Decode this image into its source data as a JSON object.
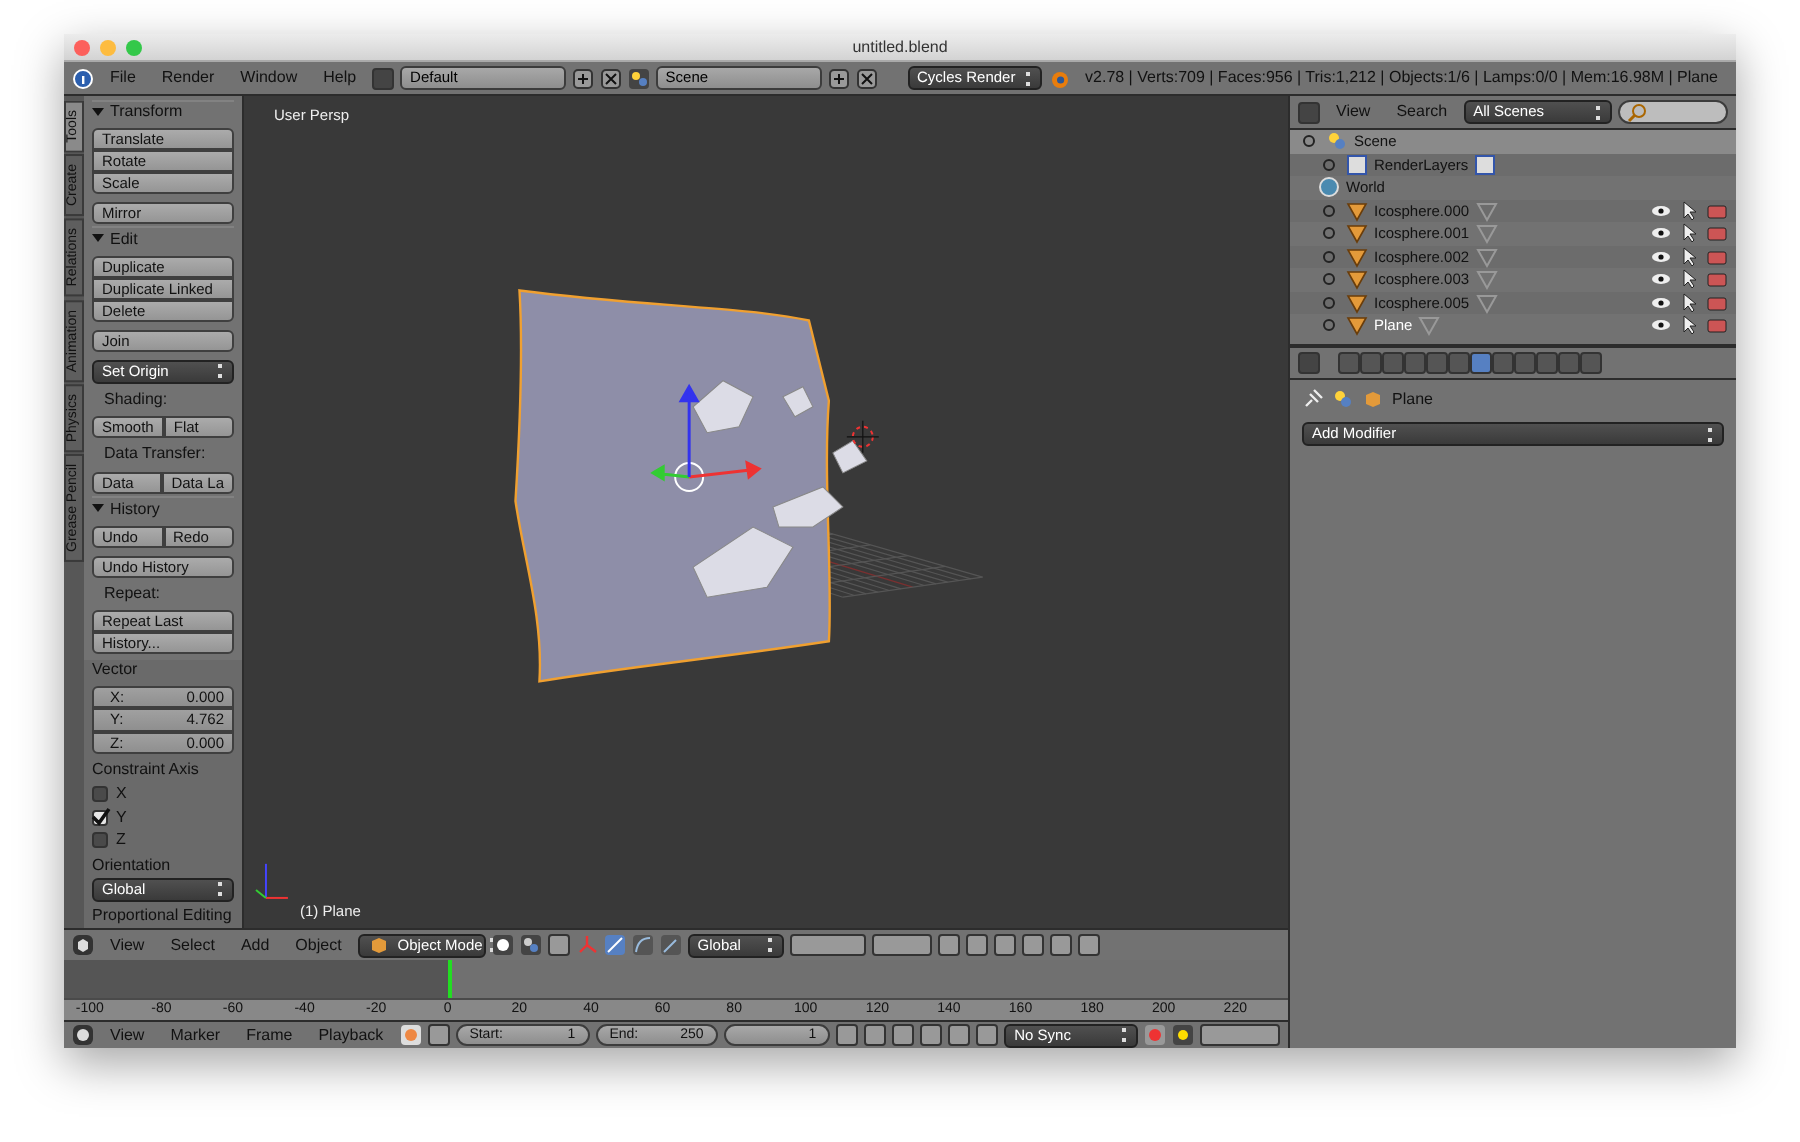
{
  "window": {
    "title": "untitled.blend"
  },
  "info_header": {
    "menus": [
      "File",
      "Render",
      "Window",
      "Help"
    ],
    "screen_layout": "Default",
    "scene": "Scene",
    "render_engine": "Cycles Render",
    "stats": "v2.78 | Verts:709 | Faces:956 | Tris:1,212 | Objects:1/6 | Lamps:0/0 | Mem:16.98M | Plane"
  },
  "tool_tabs": [
    {
      "label": "Tools",
      "selected": true
    },
    {
      "label": "Create",
      "selected": false
    },
    {
      "label": "Relations",
      "selected": false
    },
    {
      "label": "Animation",
      "selected": false
    },
    {
      "label": "Physics",
      "selected": false
    },
    {
      "label": "Grease Pencil",
      "selected": false
    }
  ],
  "tool_panels": [
    {
      "title": "Transform",
      "expanded": true,
      "rows": [
        {
          "kind": "column",
          "labels": [
            "Translate",
            "Rotate",
            "Scale"
          ]
        },
        {
          "kind": "column",
          "labels": [
            "Mirror"
          ]
        }
      ]
    },
    {
      "title": "Edit",
      "expanded": true,
      "rows": [
        {
          "kind": "column",
          "labels": [
            "Duplicate",
            "Duplicate Linked",
            "Delete"
          ]
        },
        {
          "kind": "column",
          "labels": [
            "Join"
          ]
        },
        {
          "kind": "dropdown",
          "value": "Set Origin"
        },
        {
          "kind": "label",
          "text": "Shading:"
        },
        {
          "kind": "row",
          "labels": [
            "Smooth",
            "Flat"
          ]
        },
        {
          "kind": "label",
          "text": "Data Transfer:"
        },
        {
          "kind": "row",
          "labels": [
            "Data",
            "Data La"
          ]
        }
      ]
    },
    {
      "title": "History",
      "expanded": true,
      "rows": [
        {
          "kind": "row",
          "labels": [
            "Undo",
            "Redo"
          ]
        },
        {
          "kind": "column",
          "labels": [
            "Undo History"
          ]
        },
        {
          "kind": "label",
          "text": "Repeat:"
        },
        {
          "kind": "column",
          "labels": [
            "Repeat Last",
            "History..."
          ]
        }
      ]
    }
  ],
  "operator": {
    "title": "Vector",
    "fields": [
      {
        "label": "X:",
        "value": "0.000"
      },
      {
        "label": "Y:",
        "value": "4.762"
      },
      {
        "label": "Z:",
        "value": "0.000"
      }
    ],
    "constraint_label": "Constraint Axis",
    "axes": [
      {
        "label": "X",
        "checked": false
      },
      {
        "label": "Y",
        "checked": true
      },
      {
        "label": "Z",
        "checked": false
      }
    ],
    "orientation_label": "Orientation",
    "orientation": "Global",
    "next_section": "Proportional Editing"
  },
  "viewport": {
    "view_label": "User Persp",
    "object_label": "(1) Plane"
  },
  "view3d_header": {
    "menus": [
      "View",
      "Select",
      "Add",
      "Object"
    ],
    "mode": "Object Mode",
    "orientation": "Global"
  },
  "timeline": {
    "ticks": [
      "-100",
      "-80",
      "-60",
      "-40",
      "-20",
      "0",
      "20",
      "40",
      "60",
      "80",
      "100",
      "120",
      "140",
      "160",
      "180",
      "200",
      "220"
    ]
  },
  "timeline_header": {
    "menus": [
      "View",
      "Marker",
      "Frame",
      "Playback"
    ],
    "start_label": "Start:",
    "start": "1",
    "end_label": "End:",
    "end": "250",
    "frame": "1",
    "sync": "No Sync"
  },
  "outliner": {
    "menus": [
      "View",
      "Search"
    ],
    "scope": "All Scenes",
    "tree": [
      {
        "label": "Scene",
        "kind": "scene",
        "selected": true,
        "active": false,
        "children": [
          {
            "label": "RenderLayers",
            "kind": "renderlayers",
            "selected": false,
            "active": false
          },
          {
            "label": "World",
            "kind": "world",
            "selected": false,
            "active": false
          },
          {
            "label": "Icosphere.000",
            "kind": "mesh",
            "selected": false,
            "active": false
          },
          {
            "label": "Icosphere.001",
            "kind": "mesh",
            "selected": false,
            "active": false
          },
          {
            "label": "Icosphere.002",
            "kind": "mesh",
            "selected": false,
            "active": false
          },
          {
            "label": "Icosphere.003",
            "kind": "mesh",
            "selected": false,
            "active": false
          },
          {
            "label": "Icosphere.005",
            "kind": "mesh",
            "selected": false,
            "active": false
          },
          {
            "label": "Plane",
            "kind": "mesh",
            "selected": false,
            "active": true
          }
        ]
      }
    ]
  },
  "properties": {
    "tabs": [
      {
        "selected": false
      },
      {
        "selected": false
      },
      {
        "selected": false
      },
      {
        "selected": false
      },
      {
        "selected": false
      },
      {
        "selected": false
      },
      {
        "selected": true
      },
      {
        "selected": false
      },
      {
        "selected": false
      },
      {
        "selected": false
      },
      {
        "selected": false
      },
      {
        "selected": false
      }
    ],
    "object": "Plane",
    "add_modifier": "Add Modifier"
  }
}
